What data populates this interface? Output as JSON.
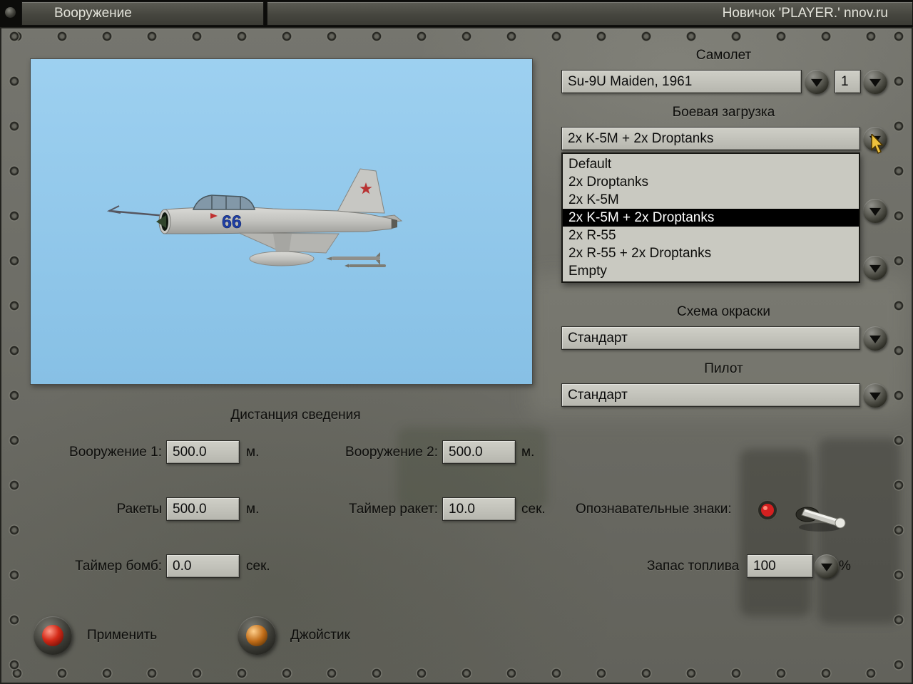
{
  "colors": {
    "selected_bg": "#000000",
    "preview_sky": "#90c8ec",
    "apply_button": "#d42a18",
    "joystick_button": "#c06c18"
  },
  "header": {
    "left_title": "Вооружение",
    "right_title": "Новичок 'PLAYER.' nnov.ru"
  },
  "aircraft_section": {
    "label": "Самолет",
    "selected": "Su-9U Maiden, 1961",
    "count": "1"
  },
  "loadout_section": {
    "label": "Боевая загрузка",
    "selected": "2x K-5M + 2x Droptanks",
    "selected_index": 3,
    "options": [
      "Default",
      "2x Droptanks",
      "2x K-5M",
      "2x K-5M + 2x Droptanks",
      "2x R-55",
      "2x R-55 + 2x Droptanks",
      "Empty"
    ]
  },
  "paint_section": {
    "label": "Схема окраски",
    "selected": "Стандарт"
  },
  "pilot_section": {
    "label": "Пилот",
    "selected": "Стандарт"
  },
  "preview": {
    "aircraft_number": "66"
  },
  "convergence": {
    "title": "Дистанция сведения",
    "weapon1": {
      "label": "Вооружение 1:",
      "value": "500.0",
      "unit": "м."
    },
    "weapon2": {
      "label": "Вооружение 2:",
      "value": "500.0",
      "unit": "м."
    },
    "rockets": {
      "label": "Ракеты",
      "value": "500.0",
      "unit": "м."
    },
    "rocket_timer": {
      "label": "Таймер ракет:",
      "value": "10.0",
      "unit": "сек."
    },
    "bomb_timer": {
      "label": "Таймер бомб:",
      "value": "0.0",
      "unit": "сек."
    }
  },
  "markings": {
    "label": "Опознавательные знаки:"
  },
  "fuel": {
    "label": "Запас топлива",
    "value": "100",
    "unit": "%"
  },
  "actions": {
    "apply": "Применить",
    "joystick": "Джойстик"
  }
}
